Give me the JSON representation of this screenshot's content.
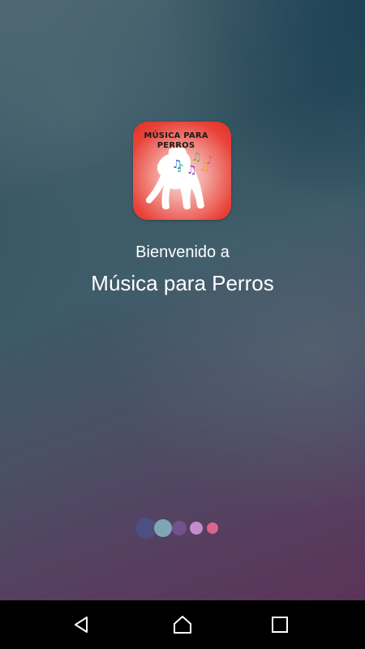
{
  "splash": {
    "icon_title": "MÚSICA PARA PERROS",
    "welcome_text": "Bienvenido a",
    "app_name": "Música para Perros"
  },
  "loading_indicator": {
    "dots": [
      {
        "color": "#4b4f82"
      },
      {
        "color": "#7fa6b4"
      },
      {
        "color": "#74508f"
      },
      {
        "color": "#c58ccc"
      },
      {
        "color": "#d9658f"
      }
    ]
  },
  "navbar": {
    "back_icon": "back-triangle-icon",
    "home_icon": "home-icon",
    "recents_icon": "recents-square-icon"
  },
  "colors": {
    "icon_red": "#e9443a",
    "text": "#ffffff",
    "navbar": "#000000"
  }
}
